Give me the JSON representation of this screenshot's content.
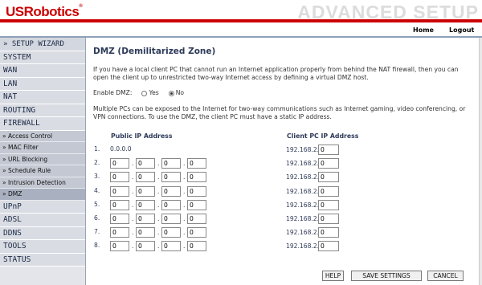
{
  "header": {
    "logo": "USRobotics",
    "logo_mark": "®",
    "title": "ADVANCED SETUP"
  },
  "topnav": {
    "home": "Home",
    "logout": "Logout"
  },
  "sidebar": {
    "setup_wizard": "» SETUP WIZARD",
    "items": [
      {
        "label": "SYSTEM"
      },
      {
        "label": "WAN"
      },
      {
        "label": "LAN"
      },
      {
        "label": "NAT"
      },
      {
        "label": "ROUTING"
      },
      {
        "label": "FIREWALL"
      }
    ],
    "firewall_sub": [
      {
        "label": "» Access Control"
      },
      {
        "label": "» MAC Filter"
      },
      {
        "label": "» URL Blocking"
      },
      {
        "label": "» Schedule Rule"
      },
      {
        "label": "» Intrusion Detection"
      },
      {
        "label": "» DMZ"
      }
    ],
    "items_after": [
      {
        "label": "UPnP"
      },
      {
        "label": "ADSL"
      },
      {
        "label": "DDNS"
      },
      {
        "label": "TOOLS"
      },
      {
        "label": "STATUS"
      }
    ]
  },
  "main": {
    "title": "DMZ (Demilitarized Zone)",
    "intro": "If you have a local client PC that cannot run an Internet application properly from behind the NAT firewall, then you can open the client up to unrestricted two-way Internet access by defining a virtual DMZ host.",
    "enable_label": "Enable DMZ:",
    "yes_label": "Yes",
    "no_label": "No",
    "enable_value": "No",
    "multi": "Multiple PCs can be exposed to the Internet for two-way communications such as Internet gaming, video conferencing, or VPN connections. To use the DMZ, the client PC must have a static IP address.",
    "col_public": "Public IP Address",
    "col_client": "Client PC IP Address",
    "rows": [
      {
        "num": "1.",
        "public": "0.0.0.0",
        "octets": null,
        "client_prefix": "192.168.2.",
        "client": "0"
      },
      {
        "num": "2.",
        "public": null,
        "octets": [
          "0",
          "0",
          "0",
          "0"
        ],
        "client_prefix": "192.168.2.",
        "client": "0"
      },
      {
        "num": "3.",
        "public": null,
        "octets": [
          "0",
          "0",
          "0",
          "0"
        ],
        "client_prefix": "192.168.2.",
        "client": "0"
      },
      {
        "num": "4.",
        "public": null,
        "octets": [
          "0",
          "0",
          "0",
          "0"
        ],
        "client_prefix": "192.168.2.",
        "client": "0"
      },
      {
        "num": "5.",
        "public": null,
        "octets": [
          "0",
          "0",
          "0",
          "0"
        ],
        "client_prefix": "192.168.2.",
        "client": "0"
      },
      {
        "num": "6.",
        "public": null,
        "octets": [
          "0",
          "0",
          "0",
          "0"
        ],
        "client_prefix": "192.168.2.",
        "client": "0"
      },
      {
        "num": "7.",
        "public": null,
        "octets": [
          "0",
          "0",
          "0",
          "0"
        ],
        "client_prefix": "192.168.2.",
        "client": "0"
      },
      {
        "num": "8.",
        "public": null,
        "octets": [
          "0",
          "0",
          "0",
          "0"
        ],
        "client_prefix": "192.168.2.",
        "client": "0"
      }
    ],
    "buttons": {
      "help": "HELP",
      "save": "SAVE SETTINGS",
      "cancel": "CANCEL"
    }
  },
  "colors": {
    "brand_red": "#cc0000",
    "nav_text": "#1c2a44",
    "title_blue": "#2d3a59"
  }
}
